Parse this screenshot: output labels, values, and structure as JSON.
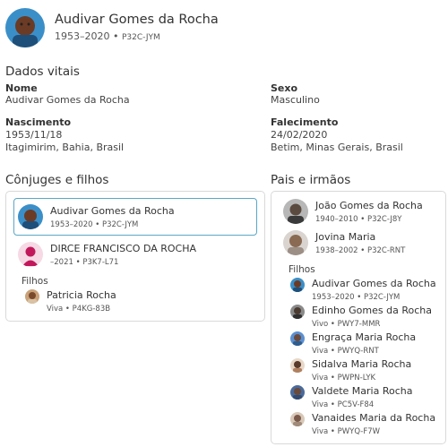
{
  "header": {
    "name": "Audivar Gomes da Rocha",
    "lifespan": "1953–2020",
    "pid": "P32C-JYM"
  },
  "vitals": {
    "title": "Dados vitais",
    "name_label": "Nome",
    "name_value": "Audivar Gomes da Rocha",
    "sex_label": "Sexo",
    "sex_value": "Masculino",
    "birth_label": "Nascimento",
    "birth_date": "1953/11/18",
    "birth_place": "Itagimirim, Bahia, Brasil",
    "death_label": "Falecimento",
    "death_date": "24/02/2020",
    "death_place": "Betim, Minas Gerais, Brasil"
  },
  "spouses": {
    "title": "Cônjuges e filhos",
    "person1": {
      "name": "Audivar Gomes da Rocha",
      "dates": "1953–2020",
      "pid": "P32C-JYM"
    },
    "person2": {
      "name": "DIRCE FRANCISCO DA ROCHA",
      "dates": "–2021",
      "pid": "P3K7-L71"
    },
    "children_label": "Filhos",
    "child1": {
      "name": "Patricia Rocha",
      "status": "Viva",
      "pid": "P4KG-83B"
    }
  },
  "parents": {
    "title": "Pais e irmãos",
    "father": {
      "name": "João Gomes da Rocha",
      "dates": "1940–2010",
      "pid": "P32C-J8Y"
    },
    "mother": {
      "name": "Jovina Maria",
      "dates": "1938–2002",
      "pid": "P32C-RNT"
    },
    "children_label": "Filhos",
    "children": [
      {
        "name": "Audivar Gomes da Rocha",
        "status": "1953–2020",
        "pid": "P32C-JYM"
      },
      {
        "name": "Edinho Gomes da Rocha",
        "status": "Vivo",
        "pid": "PWY7-MMR"
      },
      {
        "name": "Engraça Maria Rocha",
        "status": "Viva",
        "pid": "PWYQ-RNT"
      },
      {
        "name": "Sidalva Maria Rocha",
        "status": "Viva",
        "pid": "PWPN-LYK"
      },
      {
        "name": "Valdete Maria Rocha",
        "status": "Viva",
        "pid": "PC5V-F84"
      },
      {
        "name": "Vanaides Maria da Rocha",
        "status": "Viva",
        "pid": "PWYQ-F7W"
      }
    ]
  },
  "icons": {
    "header_avatar": "person-photo-icon",
    "female_silhouette": "female-silhouette-icon"
  }
}
